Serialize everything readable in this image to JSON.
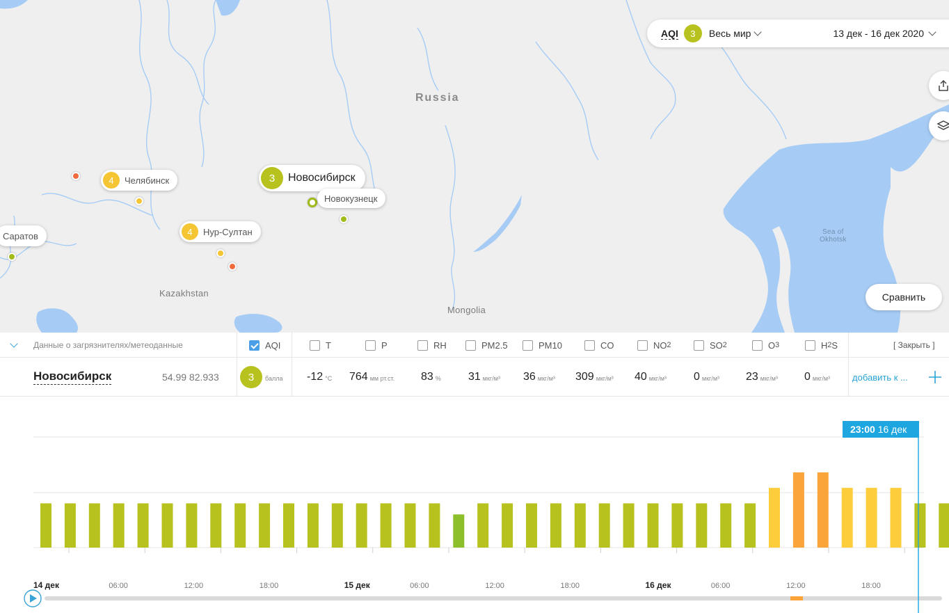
{
  "map": {
    "labels": {
      "russia": "Russia",
      "kazakhstan": "Kazakhstan",
      "mongolia": "Mongolia",
      "sea_line1": "Sea of",
      "sea_line2": "Okhotsk"
    },
    "cities": {
      "novosibirsk": {
        "name": "Новосибирск",
        "aqi": "3"
      },
      "chelyabinsk": {
        "name": "Челябинск",
        "aqi": "4"
      },
      "nur_sultan": {
        "name": "Нур-Султан",
        "aqi": "4"
      },
      "novokuznetsk": {
        "name": "Новокузнецк"
      },
      "saratov": {
        "name": "Саратов"
      }
    },
    "colors": {
      "yellow": "#f5c533",
      "green": "#b8c21e",
      "orange": "#ef6a3c",
      "water": "#a6ccf5"
    }
  },
  "topbar": {
    "aqi_label": "AQI",
    "aqi_value": "3",
    "region": "Весь мир",
    "date_range": "13 дек - 16 дек 2020"
  },
  "buttons": {
    "compare": "Сравнить",
    "share_icon": "share-icon",
    "layers_icon": "layers-icon"
  },
  "panel": {
    "header_title": "Данные о загрязнителях/метеоданные",
    "close_label": "[ Закрыть ]",
    "pollutants": {
      "aqi": {
        "label": "AQI",
        "checked": true
      },
      "t": {
        "label": "T"
      },
      "p": {
        "label": "P"
      },
      "rh": {
        "label": "RH"
      },
      "pm25": {
        "label": "PM2.5"
      },
      "pm10": {
        "label": "PM10"
      },
      "co": {
        "label": "CO"
      },
      "no2": {
        "label": "NO",
        "sub": "2"
      },
      "so2": {
        "label": "SO",
        "sub": "2"
      },
      "o3": {
        "label": "O",
        "sub": "3"
      },
      "h2s": {
        "label": "H",
        "sub": "2",
        "suffix": "S"
      }
    },
    "row": {
      "city": "Новосибирск",
      "coords": "54.99 82.933",
      "aqi": "3",
      "aqi_unit": "балла",
      "t": {
        "value": "-12",
        "unit": "°C"
      },
      "p": {
        "value": "764",
        "unit": "мм рт.ст."
      },
      "rh": {
        "value": "83",
        "unit": "%"
      },
      "pm25": {
        "value": "31",
        "unit": "мкг/м³"
      },
      "pm10": {
        "value": "36",
        "unit": "мкг/м³"
      },
      "co": {
        "value": "309",
        "unit": "мкг/м³"
      },
      "no2": {
        "value": "40",
        "unit": "мкг/м³"
      },
      "so2": {
        "value": "0",
        "unit": "мкг/м³"
      },
      "o3": {
        "value": "23",
        "unit": "мкг/м³"
      },
      "h2s": {
        "value": "0",
        "unit": "мкг/м³"
      },
      "add_link": "добавить к ..."
    }
  },
  "chart_data": {
    "type": "bar",
    "cursor_label_time": "23:00",
    "cursor_label_date": "16 дек",
    "ylim": [
      0,
      5
    ],
    "values": [
      2,
      2,
      2,
      2,
      2,
      2,
      2,
      2,
      2,
      2,
      2,
      2,
      2,
      2,
      2,
      2,
      2,
      1.5,
      2,
      2,
      2,
      2,
      2,
      2,
      2,
      2,
      2,
      2,
      2,
      2,
      2.7,
      3.4,
      3.4,
      2.7,
      2.7,
      2.7,
      2,
      2
    ],
    "levels": [
      "g",
      "g",
      "g",
      "g",
      "g",
      "g",
      "g",
      "g",
      "g",
      "g",
      "g",
      "g",
      "g",
      "g",
      "g",
      "g",
      "g",
      "d",
      "g",
      "g",
      "g",
      "g",
      "g",
      "g",
      "g",
      "g",
      "g",
      "g",
      "g",
      "g",
      "y",
      "o",
      "o",
      "y",
      "y",
      "y",
      "g",
      "g"
    ],
    "level_colors": {
      "g": "#b8c21e",
      "d": "#8cbf2a",
      "y": "#fdcd3c",
      "o": "#fba43a"
    },
    "x_labels": [
      {
        "text": "14 дек",
        "bold": true,
        "slot": 0
      },
      {
        "text": "06:00",
        "bold": false,
        "slot": 3.5
      },
      {
        "text": "12:00",
        "bold": false,
        "slot": 6.6
      },
      {
        "text": "18:00",
        "bold": false,
        "slot": 9.7
      },
      {
        "text": "15 дек",
        "bold": true,
        "slot": 12.8
      },
      {
        "text": "06:00",
        "bold": false,
        "slot": 15.9
      },
      {
        "text": "12:00",
        "bold": false,
        "slot": 19.0
      },
      {
        "text": "18:00",
        "bold": false,
        "slot": 22.1
      },
      {
        "text": "16 дек",
        "bold": true,
        "slot": 25.2
      },
      {
        "text": "06:00",
        "bold": false,
        "slot": 28.3
      },
      {
        "text": "12:00",
        "bold": false,
        "slot": 31.4
      },
      {
        "text": "18:00",
        "bold": false,
        "slot": 34.5
      }
    ]
  }
}
